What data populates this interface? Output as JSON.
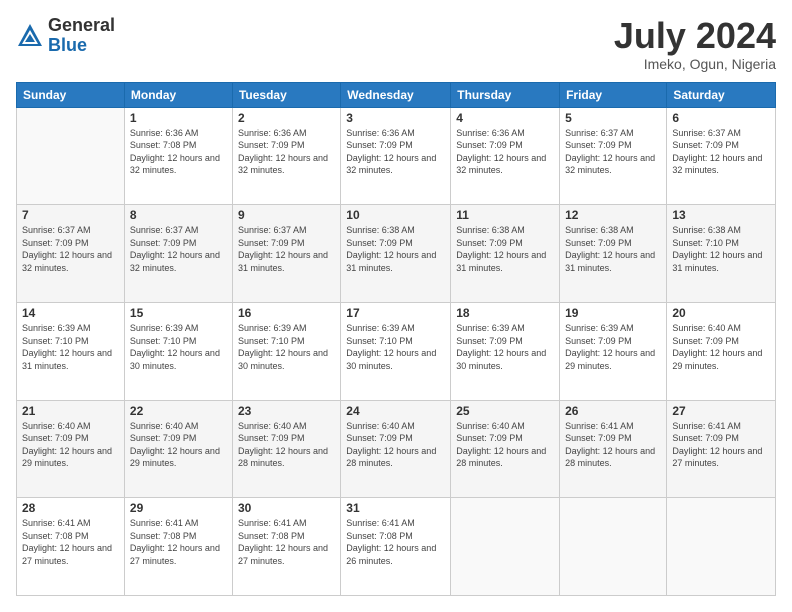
{
  "logo": {
    "general": "General",
    "blue": "Blue"
  },
  "header": {
    "month": "July 2024",
    "location": "Imeko, Ogun, Nigeria"
  },
  "days_of_week": [
    "Sunday",
    "Monday",
    "Tuesday",
    "Wednesday",
    "Thursday",
    "Friday",
    "Saturday"
  ],
  "weeks": [
    [
      {
        "day": "",
        "sunrise": "",
        "sunset": "",
        "daylight": ""
      },
      {
        "day": "1",
        "sunrise": "Sunrise: 6:36 AM",
        "sunset": "Sunset: 7:08 PM",
        "daylight": "Daylight: 12 hours and 32 minutes."
      },
      {
        "day": "2",
        "sunrise": "Sunrise: 6:36 AM",
        "sunset": "Sunset: 7:09 PM",
        "daylight": "Daylight: 12 hours and 32 minutes."
      },
      {
        "day": "3",
        "sunrise": "Sunrise: 6:36 AM",
        "sunset": "Sunset: 7:09 PM",
        "daylight": "Daylight: 12 hours and 32 minutes."
      },
      {
        "day": "4",
        "sunrise": "Sunrise: 6:36 AM",
        "sunset": "Sunset: 7:09 PM",
        "daylight": "Daylight: 12 hours and 32 minutes."
      },
      {
        "day": "5",
        "sunrise": "Sunrise: 6:37 AM",
        "sunset": "Sunset: 7:09 PM",
        "daylight": "Daylight: 12 hours and 32 minutes."
      },
      {
        "day": "6",
        "sunrise": "Sunrise: 6:37 AM",
        "sunset": "Sunset: 7:09 PM",
        "daylight": "Daylight: 12 hours and 32 minutes."
      }
    ],
    [
      {
        "day": "7",
        "sunrise": "Sunrise: 6:37 AM",
        "sunset": "Sunset: 7:09 PM",
        "daylight": "Daylight: 12 hours and 32 minutes."
      },
      {
        "day": "8",
        "sunrise": "Sunrise: 6:37 AM",
        "sunset": "Sunset: 7:09 PM",
        "daylight": "Daylight: 12 hours and 32 minutes."
      },
      {
        "day": "9",
        "sunrise": "Sunrise: 6:37 AM",
        "sunset": "Sunset: 7:09 PM",
        "daylight": "Daylight: 12 hours and 31 minutes."
      },
      {
        "day": "10",
        "sunrise": "Sunrise: 6:38 AM",
        "sunset": "Sunset: 7:09 PM",
        "daylight": "Daylight: 12 hours and 31 minutes."
      },
      {
        "day": "11",
        "sunrise": "Sunrise: 6:38 AM",
        "sunset": "Sunset: 7:09 PM",
        "daylight": "Daylight: 12 hours and 31 minutes."
      },
      {
        "day": "12",
        "sunrise": "Sunrise: 6:38 AM",
        "sunset": "Sunset: 7:09 PM",
        "daylight": "Daylight: 12 hours and 31 minutes."
      },
      {
        "day": "13",
        "sunrise": "Sunrise: 6:38 AM",
        "sunset": "Sunset: 7:10 PM",
        "daylight": "Daylight: 12 hours and 31 minutes."
      }
    ],
    [
      {
        "day": "14",
        "sunrise": "Sunrise: 6:39 AM",
        "sunset": "Sunset: 7:10 PM",
        "daylight": "Daylight: 12 hours and 31 minutes."
      },
      {
        "day": "15",
        "sunrise": "Sunrise: 6:39 AM",
        "sunset": "Sunset: 7:10 PM",
        "daylight": "Daylight: 12 hours and 30 minutes."
      },
      {
        "day": "16",
        "sunrise": "Sunrise: 6:39 AM",
        "sunset": "Sunset: 7:10 PM",
        "daylight": "Daylight: 12 hours and 30 minutes."
      },
      {
        "day": "17",
        "sunrise": "Sunrise: 6:39 AM",
        "sunset": "Sunset: 7:10 PM",
        "daylight": "Daylight: 12 hours and 30 minutes."
      },
      {
        "day": "18",
        "sunrise": "Sunrise: 6:39 AM",
        "sunset": "Sunset: 7:09 PM",
        "daylight": "Daylight: 12 hours and 30 minutes."
      },
      {
        "day": "19",
        "sunrise": "Sunrise: 6:39 AM",
        "sunset": "Sunset: 7:09 PM",
        "daylight": "Daylight: 12 hours and 29 minutes."
      },
      {
        "day": "20",
        "sunrise": "Sunrise: 6:40 AM",
        "sunset": "Sunset: 7:09 PM",
        "daylight": "Daylight: 12 hours and 29 minutes."
      }
    ],
    [
      {
        "day": "21",
        "sunrise": "Sunrise: 6:40 AM",
        "sunset": "Sunset: 7:09 PM",
        "daylight": "Daylight: 12 hours and 29 minutes."
      },
      {
        "day": "22",
        "sunrise": "Sunrise: 6:40 AM",
        "sunset": "Sunset: 7:09 PM",
        "daylight": "Daylight: 12 hours and 29 minutes."
      },
      {
        "day": "23",
        "sunrise": "Sunrise: 6:40 AM",
        "sunset": "Sunset: 7:09 PM",
        "daylight": "Daylight: 12 hours and 28 minutes."
      },
      {
        "day": "24",
        "sunrise": "Sunrise: 6:40 AM",
        "sunset": "Sunset: 7:09 PM",
        "daylight": "Daylight: 12 hours and 28 minutes."
      },
      {
        "day": "25",
        "sunrise": "Sunrise: 6:40 AM",
        "sunset": "Sunset: 7:09 PM",
        "daylight": "Daylight: 12 hours and 28 minutes."
      },
      {
        "day": "26",
        "sunrise": "Sunrise: 6:41 AM",
        "sunset": "Sunset: 7:09 PM",
        "daylight": "Daylight: 12 hours and 28 minutes."
      },
      {
        "day": "27",
        "sunrise": "Sunrise: 6:41 AM",
        "sunset": "Sunset: 7:09 PM",
        "daylight": "Daylight: 12 hours and 27 minutes."
      }
    ],
    [
      {
        "day": "28",
        "sunrise": "Sunrise: 6:41 AM",
        "sunset": "Sunset: 7:08 PM",
        "daylight": "Daylight: 12 hours and 27 minutes."
      },
      {
        "day": "29",
        "sunrise": "Sunrise: 6:41 AM",
        "sunset": "Sunset: 7:08 PM",
        "daylight": "Daylight: 12 hours and 27 minutes."
      },
      {
        "day": "30",
        "sunrise": "Sunrise: 6:41 AM",
        "sunset": "Sunset: 7:08 PM",
        "daylight": "Daylight: 12 hours and 27 minutes."
      },
      {
        "day": "31",
        "sunrise": "Sunrise: 6:41 AM",
        "sunset": "Sunset: 7:08 PM",
        "daylight": "Daylight: 12 hours and 26 minutes."
      },
      {
        "day": "",
        "sunrise": "",
        "sunset": "",
        "daylight": ""
      },
      {
        "day": "",
        "sunrise": "",
        "sunset": "",
        "daylight": ""
      },
      {
        "day": "",
        "sunrise": "",
        "sunset": "",
        "daylight": ""
      }
    ]
  ]
}
